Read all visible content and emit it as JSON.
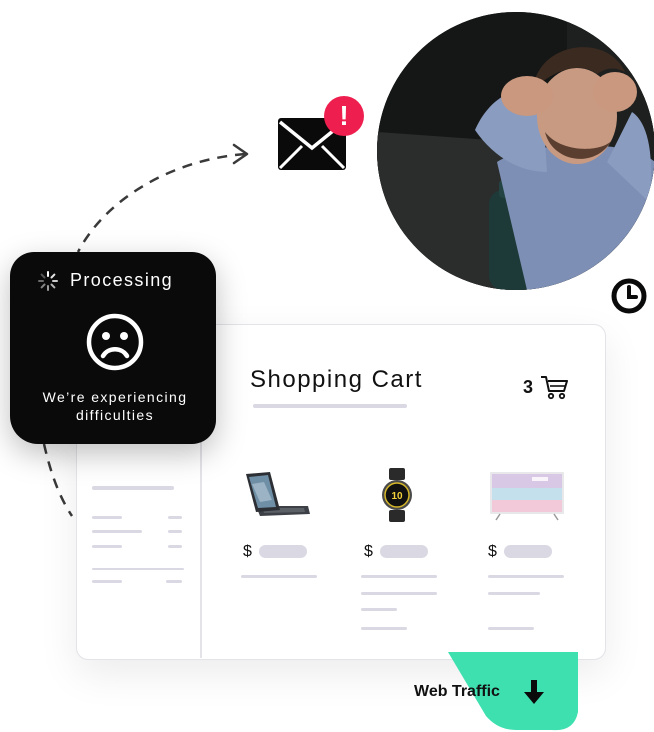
{
  "processing": {
    "title": "Processing",
    "message": "We’re experiencing\ndifficulties"
  },
  "cart": {
    "title": "Shopping Cart",
    "count": "3",
    "products": [
      {
        "name": "tablet-with-keyboard",
        "currency": "$"
      },
      {
        "name": "smartwatch",
        "currency": "$",
        "watch_face_text": "10"
      },
      {
        "name": "television",
        "currency": "$"
      }
    ]
  },
  "traffic": {
    "label": "Web Traffic"
  },
  "icons": {
    "mail": "mail-icon",
    "alert": "exclamation-icon",
    "clock": "clock-icon",
    "spinner": "spinner-icon",
    "sad": "sad-face-icon",
    "cart": "cart-icon",
    "arrow": "arrow-down-icon"
  },
  "alert_symbol": "!",
  "colors": {
    "alert": "#ee1f4f",
    "accent": "#3ee0b0",
    "popup": "#0a0a0a",
    "placeholder": "#d9d8e3"
  }
}
